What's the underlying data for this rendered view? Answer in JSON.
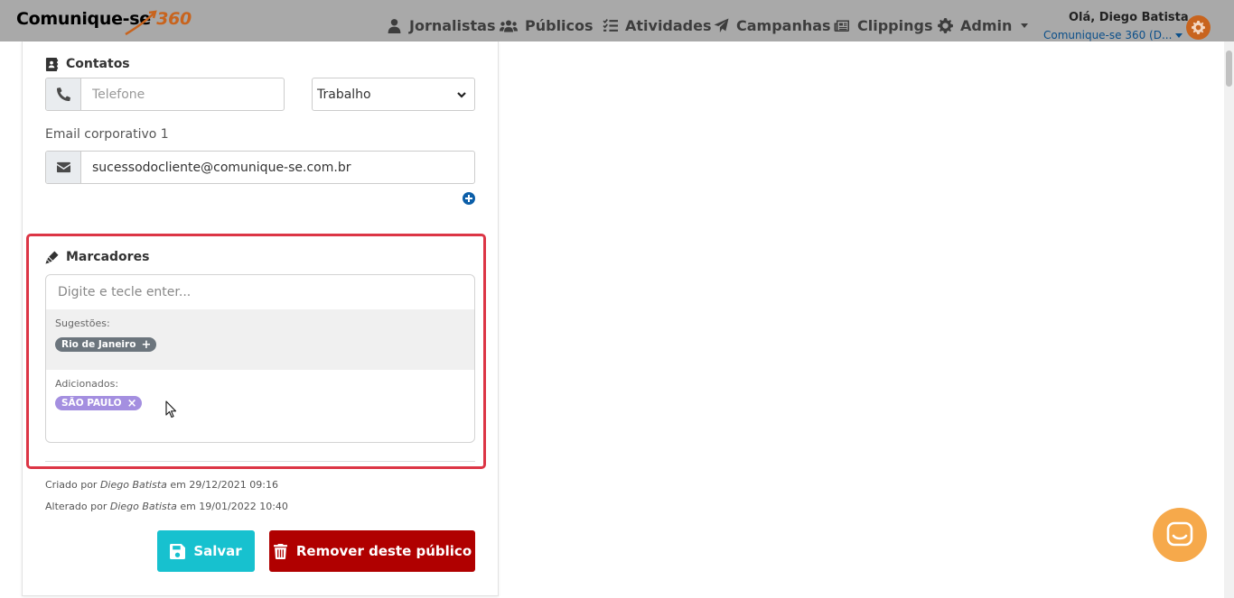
{
  "navbar": {
    "brand_text": "Comunique-se",
    "brand_number": "360",
    "items": [
      {
        "label": "Jornalistas",
        "icon": "user-tie-icon"
      },
      {
        "label": "Públicos",
        "icon": "users-icon"
      },
      {
        "label": "Atividades",
        "icon": "tasks-icon"
      },
      {
        "label": "Campanhas",
        "icon": "paper-plane-icon"
      },
      {
        "label": "Clippings",
        "icon": "newspaper-icon"
      },
      {
        "label": "Admin",
        "icon": "gear-icon"
      }
    ],
    "greeting": "Olá, Diego Batista",
    "organization": "Comunique-se 360 (D..."
  },
  "contacts": {
    "title": "Contatos",
    "phone_placeholder": "Telefone",
    "phone_type": "Trabalho",
    "email_label": "Email corporativo 1",
    "email_value": "sucessodocliente@comunique-se.com.br"
  },
  "markers": {
    "title": "Marcadores",
    "input_placeholder": "Digite e tecle enter...",
    "suggestions_label": "Sugestões:",
    "suggestions": [
      "Rio de Janeiro"
    ],
    "added_label": "Adicionados:",
    "added": [
      "SÃO PAULO"
    ]
  },
  "meta": {
    "created_prefix": "Criado por",
    "created_by": "Diego Batista",
    "created_at": "em 29/12/2021 09:16",
    "updated_prefix": "Alterado por",
    "updated_by": "Diego Batista",
    "updated_at": "em 19/01/2022 10:40"
  },
  "actions": {
    "save_label": "Salvar",
    "remove_label": "Remover deste público"
  },
  "colors": {
    "brand_orange": "#c8641e",
    "save": "#17c1cf",
    "remove": "#b00000",
    "highlight": "#dc3545",
    "chip_added": "#a48fe0",
    "chip_suggest": "#6c757d"
  }
}
